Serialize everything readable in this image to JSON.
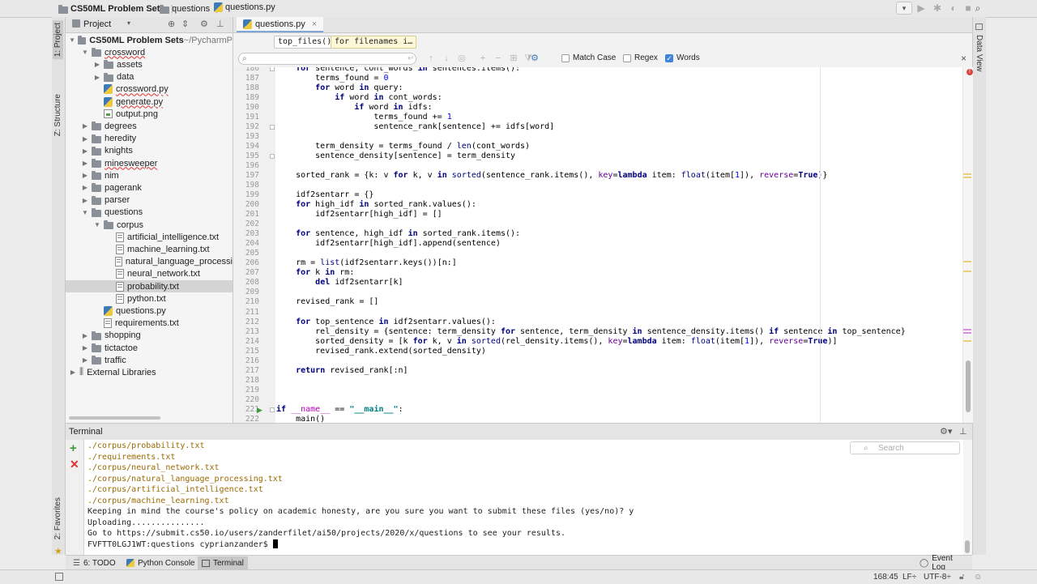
{
  "navbar": {
    "crumbs": [
      "CS50ML Problem Sets",
      "questions",
      "questions.py"
    ]
  },
  "left_strip": {
    "project_tab": "1: Project",
    "structure_tab": "Z: Structure",
    "favorites_tab": "2: Favorites"
  },
  "right_strip": {
    "data_view_tab": "Data View"
  },
  "project_panel": {
    "header": "Project",
    "tree": [
      {
        "label": "CS50ML Problem Sets",
        "suffix": "~/PycharmP",
        "type": "folder",
        "depth": 0,
        "expanded": true
      },
      {
        "label": "crossword",
        "type": "folder",
        "depth": 1,
        "expanded": true,
        "error": true
      },
      {
        "label": "assets",
        "type": "folder",
        "depth": 2,
        "expanded": false
      },
      {
        "label": "data",
        "type": "folder",
        "depth": 2,
        "expanded": false
      },
      {
        "label": "crossword.py",
        "type": "py",
        "depth": 2,
        "error": true
      },
      {
        "label": "generate.py",
        "type": "py",
        "depth": 2,
        "error": true
      },
      {
        "label": "output.png",
        "type": "img",
        "depth": 2
      },
      {
        "label": "degrees",
        "type": "folder",
        "depth": 1,
        "expanded": false
      },
      {
        "label": "heredity",
        "type": "folder",
        "depth": 1,
        "expanded": false
      },
      {
        "label": "knights",
        "type": "folder",
        "depth": 1,
        "expanded": false
      },
      {
        "label": "minesweeper",
        "type": "folder",
        "depth": 1,
        "expanded": false,
        "error": true
      },
      {
        "label": "nim",
        "type": "folder",
        "depth": 1,
        "expanded": false
      },
      {
        "label": "pagerank",
        "type": "folder",
        "depth": 1,
        "expanded": false
      },
      {
        "label": "parser",
        "type": "folder",
        "depth": 1,
        "expanded": false
      },
      {
        "label": "questions",
        "type": "folder",
        "depth": 1,
        "expanded": true
      },
      {
        "label": "corpus",
        "type": "folder",
        "depth": 2,
        "expanded": true
      },
      {
        "label": "artificial_intelligence.txt",
        "type": "txt",
        "depth": 3
      },
      {
        "label": "machine_learning.txt",
        "type": "txt",
        "depth": 3
      },
      {
        "label": "natural_language_processi",
        "type": "txt",
        "depth": 3
      },
      {
        "label": "neural_network.txt",
        "type": "txt",
        "depth": 3
      },
      {
        "label": "probability.txt",
        "type": "txt",
        "depth": 3,
        "selected": true
      },
      {
        "label": "python.txt",
        "type": "txt",
        "depth": 3
      },
      {
        "label": "questions.py",
        "type": "py",
        "depth": 2
      },
      {
        "label": "requirements.txt",
        "type": "txt",
        "depth": 2
      },
      {
        "label": "shopping",
        "type": "folder",
        "depth": 1,
        "expanded": false
      },
      {
        "label": "tictactoe",
        "type": "folder",
        "depth": 1,
        "expanded": false
      },
      {
        "label": "traffic",
        "type": "folder",
        "depth": 1,
        "expanded": false
      },
      {
        "label": "External Libraries",
        "type": "lib",
        "depth": 0,
        "expanded": false
      }
    ]
  },
  "editor": {
    "tab": "questions.py",
    "breadcrumb": [
      "top_files()",
      "for filenames i…"
    ],
    "find": {
      "placeholder": "Q",
      "match_case": "Match Case",
      "regex": "Regex",
      "words": "Words",
      "match_case_checked": false,
      "regex_checked": false,
      "words_checked": true
    },
    "lines": [
      {
        "n": 186,
        "code": "    for sentence, cont_words in sentences.items():"
      },
      {
        "n": 187,
        "code": "        terms_found = 0"
      },
      {
        "n": 188,
        "code": "        for word in query:"
      },
      {
        "n": 189,
        "code": "            if word in cont_words:"
      },
      {
        "n": 190,
        "code": "                if word in idfs:"
      },
      {
        "n": 191,
        "code": "                    terms_found += 1"
      },
      {
        "n": 192,
        "code": "                    sentence_rank[sentence] += idfs[word]"
      },
      {
        "n": 193,
        "code": ""
      },
      {
        "n": 194,
        "code": "        term_density = terms_found / len(cont_words)"
      },
      {
        "n": 195,
        "code": "        sentence_density[sentence] = term_density"
      },
      {
        "n": 196,
        "code": ""
      },
      {
        "n": 197,
        "code": "    sorted_rank = {k: v for k, v in sorted(sentence_rank.items(), key=lambda item: float(item[1]), reverse=True)}"
      },
      {
        "n": 198,
        "code": ""
      },
      {
        "n": 199,
        "code": "    idf2sentarr = {}"
      },
      {
        "n": 200,
        "code": "    for high_idf in sorted_rank.values():"
      },
      {
        "n": 201,
        "code": "        idf2sentarr[high_idf] = []"
      },
      {
        "n": 202,
        "code": ""
      },
      {
        "n": 203,
        "code": "    for sentence, high_idf in sorted_rank.items():"
      },
      {
        "n": 204,
        "code": "        idf2sentarr[high_idf].append(sentence)"
      },
      {
        "n": 205,
        "code": ""
      },
      {
        "n": 206,
        "code": "    rm = list(idf2sentarr.keys())[n:]"
      },
      {
        "n": 207,
        "code": "    for k in rm:"
      },
      {
        "n": 208,
        "code": "        del idf2sentarr[k]"
      },
      {
        "n": 209,
        "code": ""
      },
      {
        "n": 210,
        "code": "    revised_rank = []"
      },
      {
        "n": 211,
        "code": ""
      },
      {
        "n": 212,
        "code": "    for top_sentence in idf2sentarr.values():"
      },
      {
        "n": 213,
        "code": "        rel_density = {sentence: term_density for sentence, term_density in sentence_density.items() if sentence in top_sentence}"
      },
      {
        "n": 214,
        "code": "        sorted_density = [k for k, v in sorted(rel_density.items(), key=lambda item: float(item[1]), reverse=True)]"
      },
      {
        "n": 215,
        "code": "        revised_rank.extend(sorted_density)"
      },
      {
        "n": 216,
        "code": ""
      },
      {
        "n": 217,
        "code": "    return revised_rank[:n]"
      },
      {
        "n": 218,
        "code": ""
      },
      {
        "n": 219,
        "code": ""
      },
      {
        "n": 220,
        "code": ""
      },
      {
        "n": 221,
        "code": "if __name__ == \"__main__\":"
      },
      {
        "n": 222,
        "code": "    main()"
      }
    ]
  },
  "terminal": {
    "title": "Terminal",
    "search_placeholder": "Search",
    "lines": [
      {
        "text": "./corpus/probability.txt",
        "kind": "path"
      },
      {
        "text": "./requirements.txt",
        "kind": "path"
      },
      {
        "text": "./corpus/neural_network.txt",
        "kind": "path"
      },
      {
        "text": "./corpus/natural_language_processing.txt",
        "kind": "path"
      },
      {
        "text": "./corpus/artificial_intelligence.txt",
        "kind": "path"
      },
      {
        "text": "./corpus/machine_learning.txt",
        "kind": "path"
      },
      {
        "text": "Keeping in mind the course's policy on academic honesty, are you sure you want to submit these files (yes/no)? y",
        "kind": "plain"
      },
      {
        "text": "Uploading...............",
        "kind": "plain"
      },
      {
        "text": "Go to https://submit.cs50.io/users/zanderfilet/ai50/projects/2020/x/questions to see your results.",
        "kind": "plain"
      },
      {
        "text": "FVFTT0LGJ1WT:questions cyprianzander$ ",
        "kind": "prompt"
      }
    ]
  },
  "tool_windows": {
    "todo": "6: TODO",
    "python_console": "Python Console",
    "terminal": "Terminal",
    "event_log": "Event Log"
  },
  "status": {
    "position": "168:45",
    "line_sep": "LF÷",
    "encoding": "UTF-8÷"
  },
  "colors": {
    "keyword": "#000080",
    "number": "#0000ff",
    "path_output": "#9a6a00",
    "accent": "#3d84dc"
  }
}
